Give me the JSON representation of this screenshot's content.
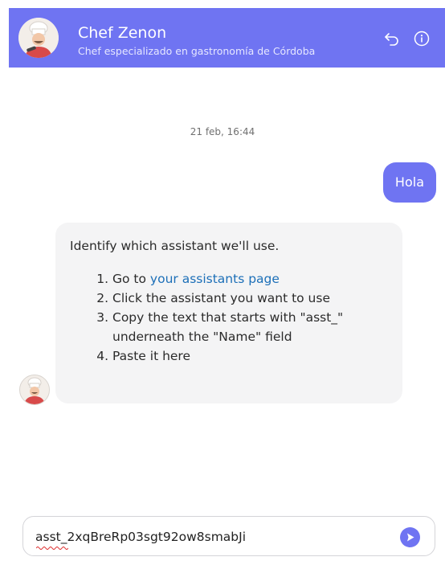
{
  "header": {
    "title": "Chef Zenon",
    "subtitle": "Chef especializado en gastronomía de Córdoba",
    "accent_color": "#6f74f2",
    "icons": [
      "chef-avatar-icon",
      "back-arrow-icon",
      "info-icon"
    ]
  },
  "conversation": {
    "date": "21 feb, 16:44",
    "user_message": "Hola",
    "bot_message": {
      "intro": "Identify which assistant we'll use.",
      "steps": [
        {
          "prefix": "Go to ",
          "link": "your assistants page",
          "suffix": ""
        },
        {
          "text": "Click the assistant you want to use"
        },
        {
          "text": "Copy the text that starts with \"asst_\" underneath the \"Name\" field"
        },
        {
          "text": "Paste it here"
        }
      ]
    }
  },
  "composer": {
    "value": "asst_2xqBreRp03sgt92ow8smabJi",
    "send_icon": "send-arrow-icon"
  }
}
